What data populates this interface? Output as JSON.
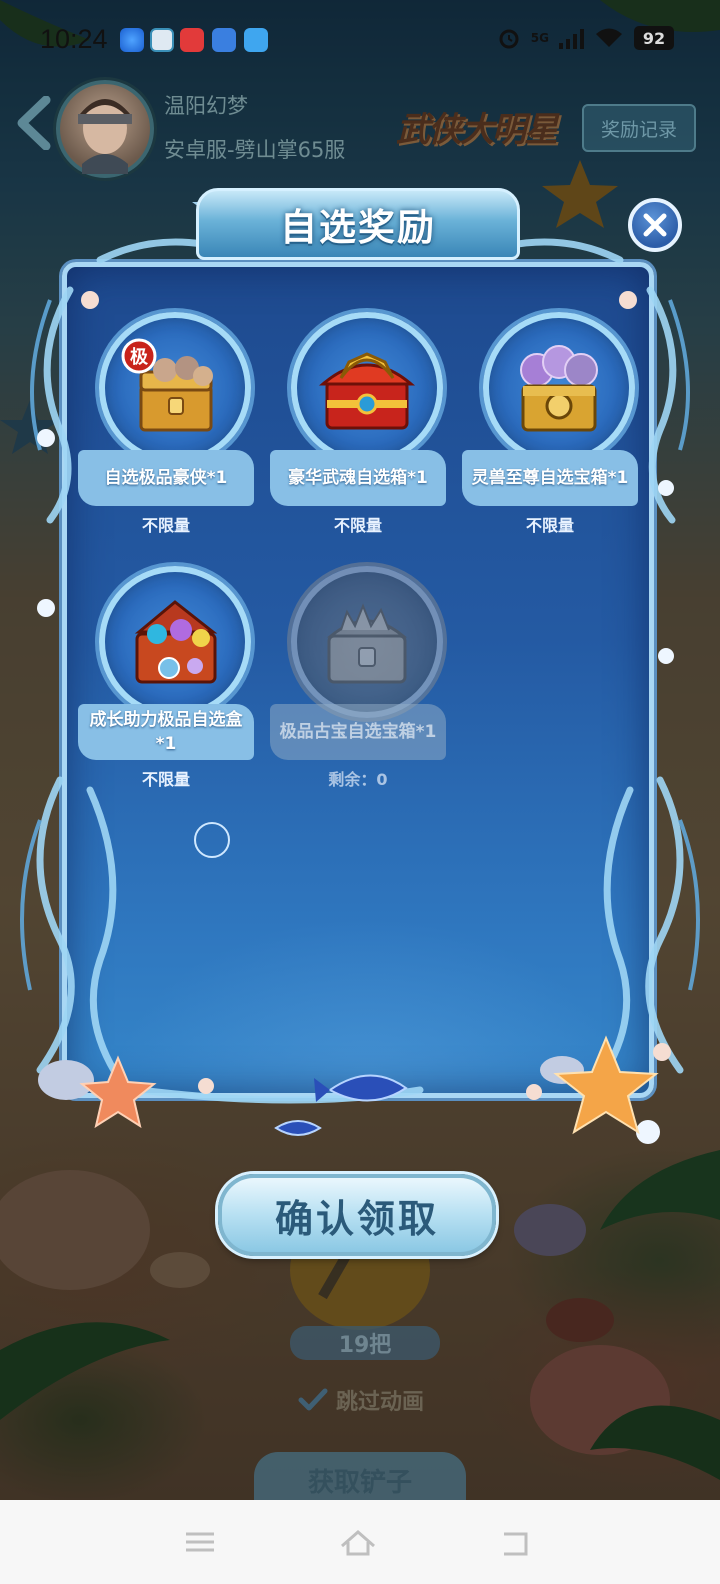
{
  "status_bar": {
    "time": "10:24",
    "network": "5G",
    "battery": "92"
  },
  "game_header": {
    "player_name": "温阳幻梦",
    "server_name": "安卓服-劈山掌65服",
    "logo_text": "武侠大明星",
    "record_button": "奖励记录"
  },
  "modal": {
    "title": "自选奖励",
    "rewards": [
      {
        "name": "自选极品豪侠*1",
        "limit": "不限量",
        "icon": "hero-chest-icon",
        "badge": "极",
        "enabled": true
      },
      {
        "name": "豪华武魂自选箱*1",
        "limit": "不限量",
        "icon": "dragon-chest-icon",
        "enabled": true
      },
      {
        "name": "灵兽至尊自选宝箱*1",
        "limit": "不限量",
        "icon": "beast-chest-icon",
        "enabled": true
      },
      {
        "name": "成长助力极品自选盒*1",
        "limit": "不限量",
        "icon": "growth-chest-icon",
        "enabled": true
      },
      {
        "name": "极品古宝自选宝箱*1",
        "limit": "剩余：0",
        "icon": "treasure-chest-icon",
        "enabled": false
      }
    ],
    "confirm_button": "确认领取"
  },
  "background_ui": {
    "shovel_count": "19把",
    "skip_animation": "跳过动画",
    "get_shovel_button": "获取铲子"
  },
  "colors": {
    "modal_blue": "#245aa3",
    "frame_light": "#a9d7f4",
    "label_blue": "#88bfe6"
  }
}
